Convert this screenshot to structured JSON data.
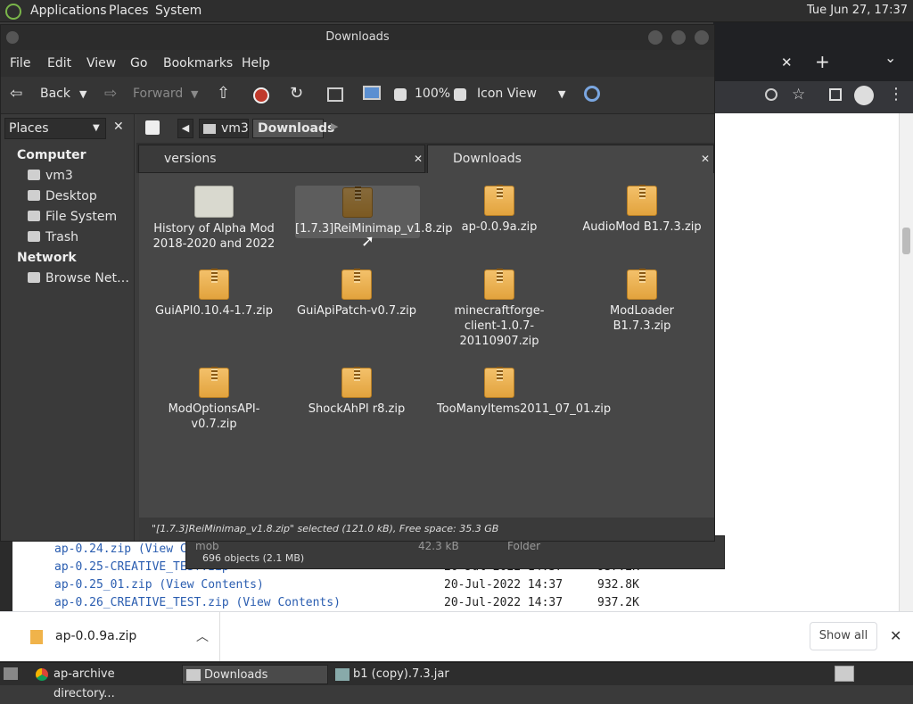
{
  "top_panel": {
    "applications": "Applications",
    "places": "Places",
    "system": "System",
    "clock": "Tue Jun 27, 17:37"
  },
  "browser": {
    "tab_close": "✕",
    "new_tab": "+",
    "dropdown": "⌄",
    "listing": [
      {
        "name": "ap-0.24.zip",
        "contents": "(View C",
        "date": "",
        "size": ""
      },
      {
        "name": "ap-0.25-CREATIVE_TEST.zip",
        "contents": "",
        "date": "20-Jul-2022 14:37",
        "size": "937.2K"
      },
      {
        "name": "ap-0.25_01.zip",
        "contents": "(View Contents)",
        "date": "20-Jul-2022 14:37",
        "size": "932.8K"
      },
      {
        "name": "ap-0.26_CREATIVE_TEST.zip",
        "contents": "(View Contents)",
        "date": "20-Jul-2022 14:37",
        "size": "937.2K"
      }
    ],
    "download_item": "ap-0.0.9a.zip",
    "show_all": "Show all",
    "close": "✕"
  },
  "nautilus": {
    "title": "Downloads",
    "menu": [
      "File",
      "Edit",
      "View",
      "Go",
      "Bookmarks",
      "Help"
    ],
    "toolbar": {
      "back": "Back",
      "forward": "Forward",
      "zoom": "100%",
      "view_mode": "Icon View"
    },
    "sidebar": {
      "header": "Places",
      "sections": [
        {
          "title": "Computer",
          "items": [
            "vm3",
            "Desktop",
            "File System",
            "Trash"
          ]
        },
        {
          "title": "Network",
          "items": [
            "Browse Net…"
          ]
        }
      ]
    },
    "path": [
      "vm3",
      "Downloads"
    ],
    "tabs": [
      "versions",
      "Downloads"
    ],
    "files": [
      {
        "name": "History of Alpha Mod 2018-2020 and 2022",
        "kind": "folder"
      },
      {
        "name": "[1.7.3]ReiMinimap_v1.8.zip",
        "kind": "zip",
        "selected": true
      },
      {
        "name": "ap-0.0.9a.zip",
        "kind": "zip"
      },
      {
        "name": "AudioMod B1.7.3.zip",
        "kind": "zip"
      },
      {
        "name": "GuiAPI0.10.4-1.7.zip",
        "kind": "zip"
      },
      {
        "name": "GuiApiPatch-v0.7.zip",
        "kind": "zip"
      },
      {
        "name": "minecraftforge-client-1.0.7-20110907.zip",
        "kind": "zip"
      },
      {
        "name": "ModLoader B1.7.3.zip",
        "kind": "zip"
      },
      {
        "name": "ModOptionsAPI-v0.7.zip",
        "kind": "zip"
      },
      {
        "name": "ShockAhPI r8.zip",
        "kind": "zip"
      },
      {
        "name": "TooManyItems2011_07_01.zip",
        "kind": "zip"
      }
    ],
    "status": "\"[1.7.3]ReiMinimap_v1.8.zip\" selected (121.0 kB), Free space: 35.3 GB"
  },
  "nautilus2": {
    "row": {
      "name": "mob",
      "size": "42.3 kB",
      "type": "Folder"
    },
    "status": "696 objects (2.1 MB)"
  },
  "taskbar": [
    {
      "label": "ap-archive directory..."
    },
    {
      "label": "Downloads"
    },
    {
      "label": "b1 (copy).7.3.jar"
    }
  ]
}
